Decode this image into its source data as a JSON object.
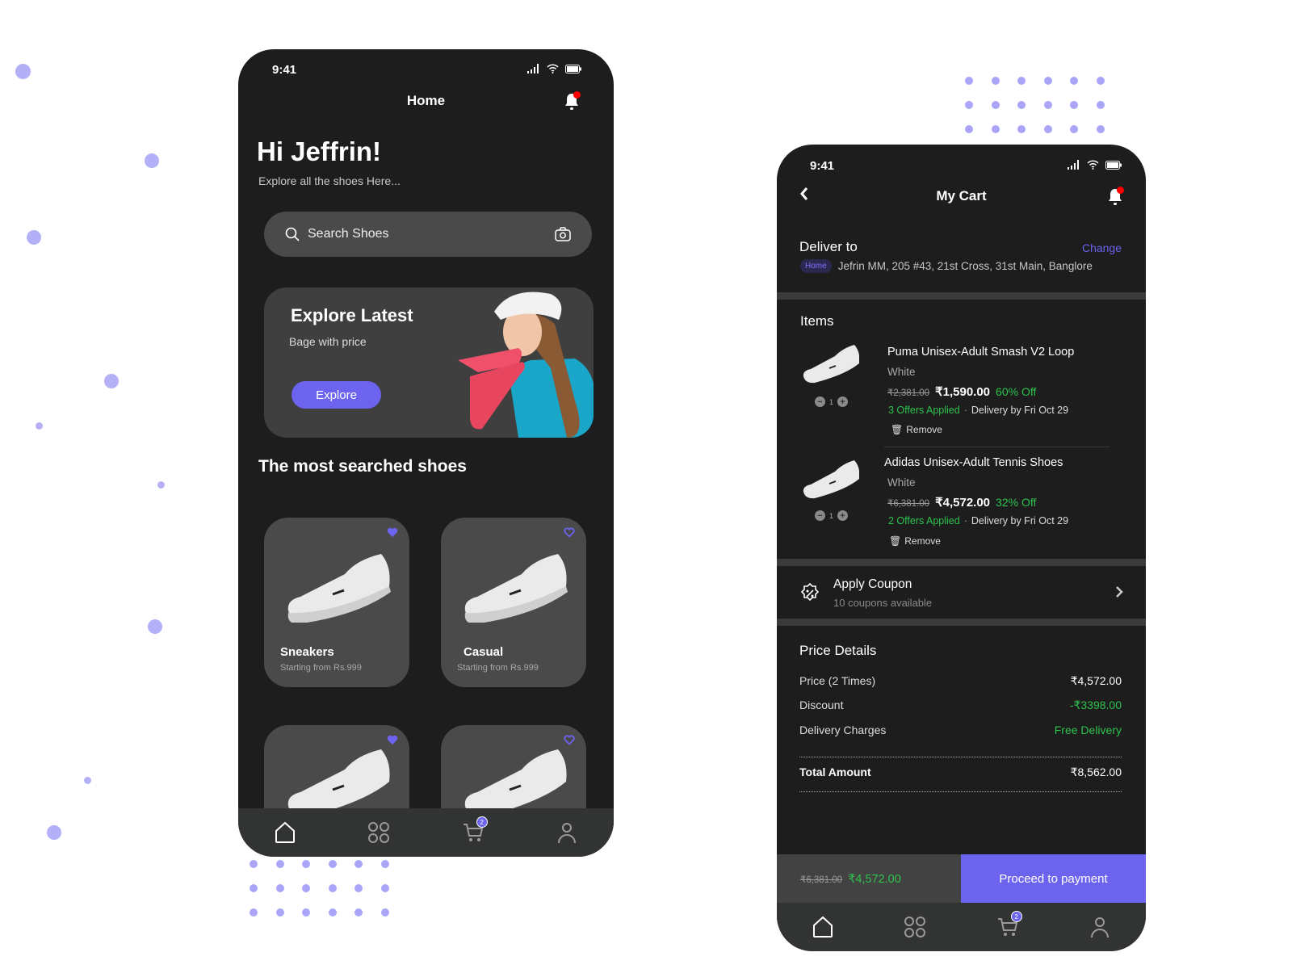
{
  "home": {
    "status_time": "9:41",
    "title": "Home",
    "greeting": "Hi Jeffrin!",
    "subtitle": "Explore all the shoes Here...",
    "search_placeholder": "Search Shoes",
    "banner": {
      "title": "Explore Latest",
      "subtitle": "Bage with price",
      "button": "Explore"
    },
    "section_title": "The most searched shoes",
    "products": [
      {
        "name": "Sneakers",
        "subtitle": "Starting from Rs.999",
        "favorite": true
      },
      {
        "name": "Casual",
        "subtitle": "Starting from Rs.999",
        "favorite": false
      },
      {
        "name": "",
        "subtitle": "",
        "favorite": true
      },
      {
        "name": "",
        "subtitle": "",
        "favorite": false
      }
    ],
    "nav": {
      "cart_badge": "2"
    }
  },
  "cart": {
    "status_time": "9:41",
    "title": "My Cart",
    "deliver_to": "Deliver to",
    "change": "Change",
    "address_tag": "Home",
    "address": "Jefrin MM, 205 #43, 21st Cross, 31st Main, Banglore",
    "items_title": "Items",
    "items": [
      {
        "name": "Puma Unisex-Adult Smash V2 Loop",
        "color": "White",
        "old_price": "₹2,381.00",
        "price": "₹1,590.00",
        "discount": "60% Off",
        "offers": "3 Offers Applied",
        "delivery": "Delivery by Fri Oct 29",
        "remove": "Remove",
        "qty": "1"
      },
      {
        "name": "Adidas Unisex-Adult Tennis Shoes",
        "color": "White",
        "old_price": "₹6,381.00",
        "price": "₹4,572.00",
        "discount": "32% Off",
        "offers": "2 Offers Applied",
        "delivery": "Delivery by Fri Oct 29",
        "remove": "Remove",
        "qty": "1"
      }
    ],
    "coupon": {
      "title": "Apply Coupon",
      "subtitle": "10 coupons available"
    },
    "price_details": {
      "title": "Price Details",
      "rows": [
        {
          "label": "Price (2 Times)",
          "value": "₹4,572.00"
        },
        {
          "label": "Discount",
          "value": "-₹3398.00"
        },
        {
          "label": "Delivery Charges",
          "value": "Free Delivery"
        }
      ],
      "total_label": "Total Amount",
      "total_value": "₹8,562.00"
    },
    "checkout": {
      "old_price": "₹6,381.00",
      "price": "₹4,572.00",
      "button": "Proceed to payment"
    },
    "nav": {
      "cart_badge": "2"
    }
  },
  "colors": {
    "accent": "#6c63ef",
    "green": "#2ec24e",
    "background": "#1d1d1d",
    "decor": "#b4b0f7"
  }
}
